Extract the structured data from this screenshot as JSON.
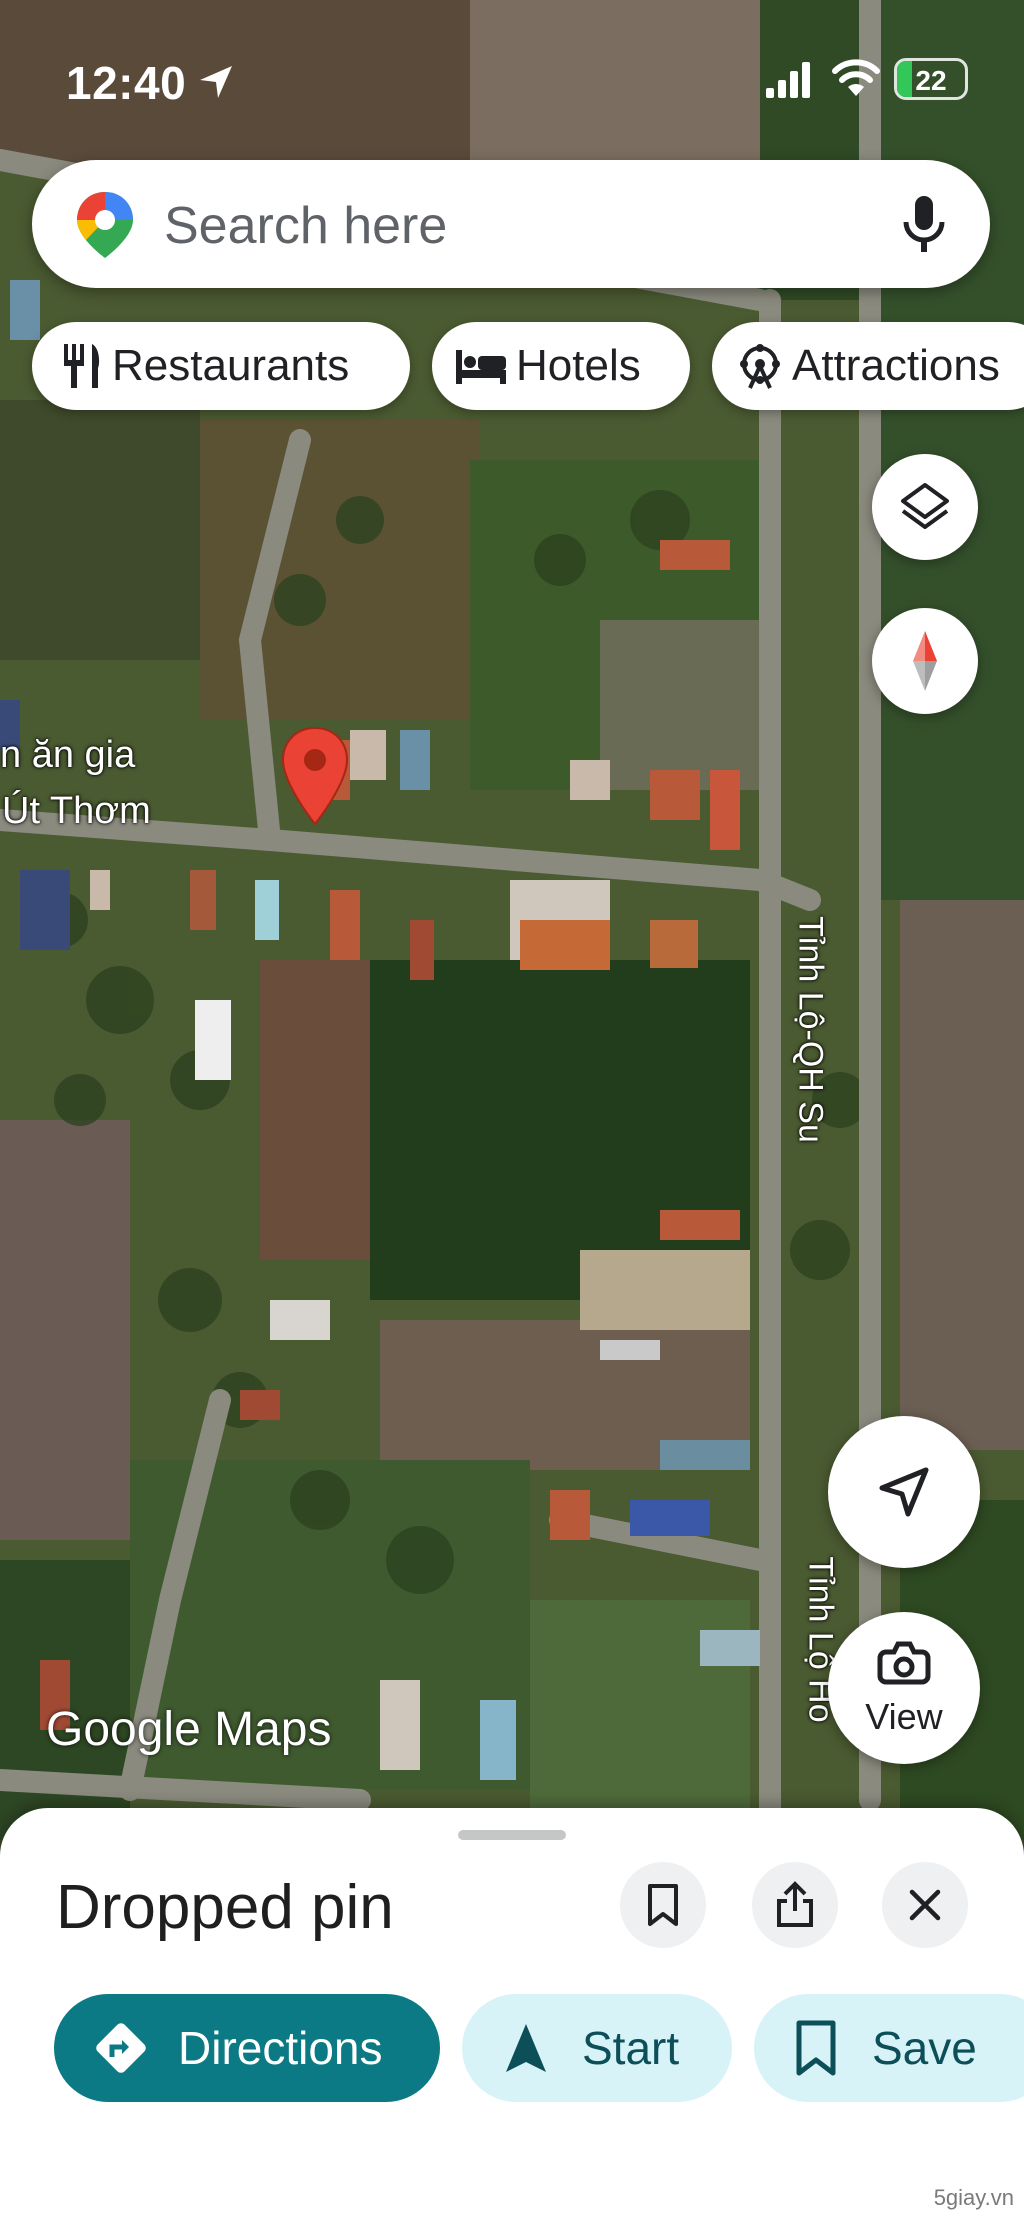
{
  "status_bar": {
    "time": "12:40",
    "battery": "22"
  },
  "search": {
    "placeholder": "Search here"
  },
  "chips": [
    {
      "label": "Restaurants",
      "icon": "fork-knife-icon"
    },
    {
      "label": "Hotels",
      "icon": "bed-icon"
    },
    {
      "label": "Attractions",
      "icon": "ferris-wheel-icon"
    }
  ],
  "map": {
    "place_label_line1": "n ăn gia",
    "place_label_line2": "Út Thơm",
    "road_label": "Tỉnh Lộ-QH Su",
    "road_label_2": "Tỉnh Lộ Ho",
    "watermark": "Google Maps",
    "pin_color": "#ea4335"
  },
  "controls": {
    "view_label": "View"
  },
  "sheet": {
    "title": "Dropped pin",
    "actions": [
      {
        "label": "Directions"
      },
      {
        "label": "Start"
      },
      {
        "label": "Save"
      }
    ]
  },
  "credit": "5giay.vn",
  "colors": {
    "primary": "#0b7a85",
    "light_pill": "#d8f3f8",
    "dark_text": "#0d4f59"
  }
}
